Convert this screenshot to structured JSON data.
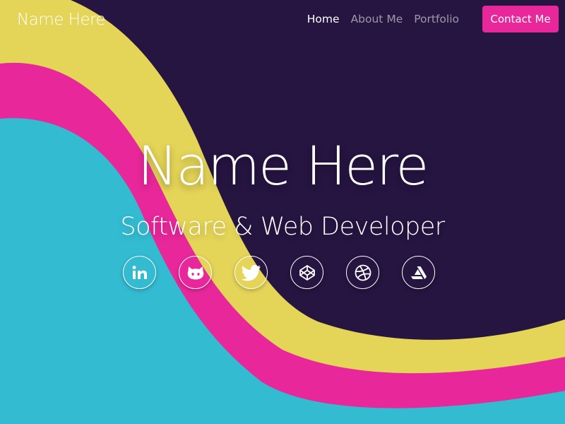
{
  "brand": {
    "name": "Name Here"
  },
  "nav": {
    "items": [
      {
        "label": "Home",
        "active": true
      },
      {
        "label": "About Me",
        "active": false
      },
      {
        "label": "Portfolio",
        "active": false
      }
    ],
    "contact_label": "Contact Me"
  },
  "hero": {
    "name": "Name Here",
    "role": "Software & Web Developer"
  },
  "socials": [
    {
      "icon": "linkedin-icon"
    },
    {
      "icon": "github-icon"
    },
    {
      "icon": "twitter-icon"
    },
    {
      "icon": "codepen-icon"
    },
    {
      "icon": "dribbble-icon"
    },
    {
      "icon": "artstation-icon"
    }
  ],
  "colors": {
    "background": "#261441",
    "yellow": "#e4d457",
    "pink": "#e8279a",
    "cyan": "#33bbd1",
    "button": "#e8279a",
    "text": "#ffffff"
  }
}
